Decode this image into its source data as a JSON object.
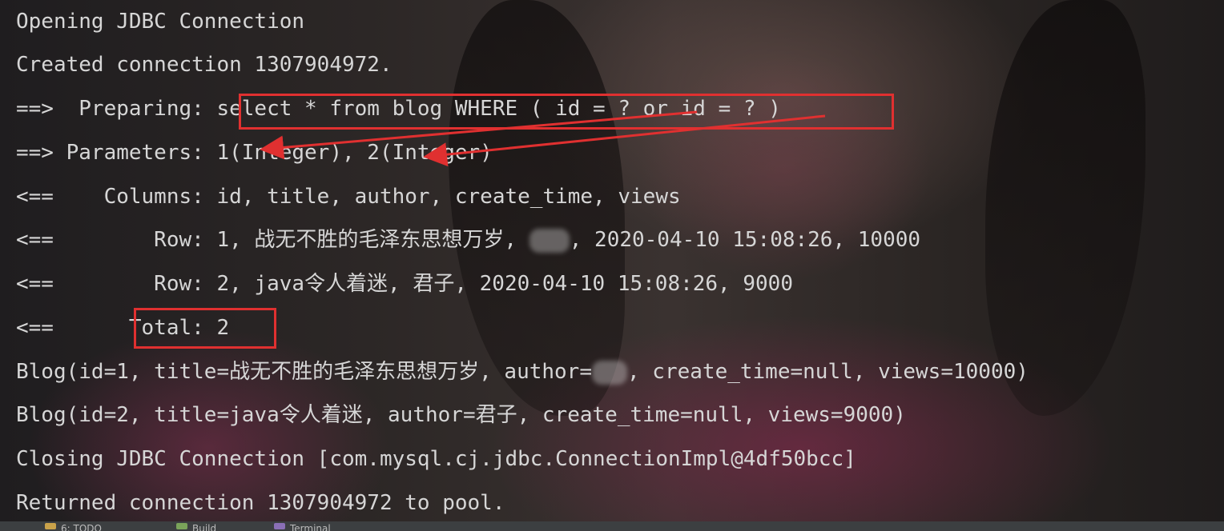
{
  "console": {
    "lines": [
      {
        "text": "Opening JDBC Connection"
      },
      {
        "text": "Created connection 1307904972."
      },
      {
        "prefix": "==>  Preparing: ",
        "sql": "select * from blog WHERE ( id = ? or id = ? )"
      },
      {
        "text": "==> Parameters: 1(Integer), 2(Integer)"
      },
      {
        "text": "<==    Columns: id, title, author, create_time, views"
      },
      {
        "before": "<==        Row: 1, 战无不胜的毛泽东思想万岁, ",
        "after": ", 2020-04-10 15:08:26, 10000"
      },
      {
        "text": "<==        Row: 2, java令人着迷, 君子, 2020-04-10 15:08:26, 9000"
      },
      {
        "prefix": "<==      ",
        "total": "Total: 2"
      },
      {
        "before": "Blog(id=1, title=战无不胜的毛泽东思想万岁, author=",
        "after": ", create_time=null, views=10000)"
      },
      {
        "text": "Blog(id=2, title=java令人着迷, author=君子, create_time=null, views=9000)"
      },
      {
        "text": "Closing JDBC Connection [com.mysql.cj.jdbc.ConnectionImpl@4df50bcc]"
      },
      {
        "text": "Returned connection 1307904972 to pool."
      }
    ]
  },
  "toolbar": {
    "tabs": [
      {
        "label": "6: TODO",
        "icon": "todo-icon",
        "color": "#c9a24a"
      },
      {
        "label": "Build",
        "icon": "build-icon",
        "color": "#7aa35a"
      },
      {
        "label": "Terminal",
        "icon": "terminal-icon",
        "color": "#8a6fb5"
      }
    ]
  },
  "colors": {
    "text": "#d6d6d6",
    "annotation_red": "#e03030"
  }
}
